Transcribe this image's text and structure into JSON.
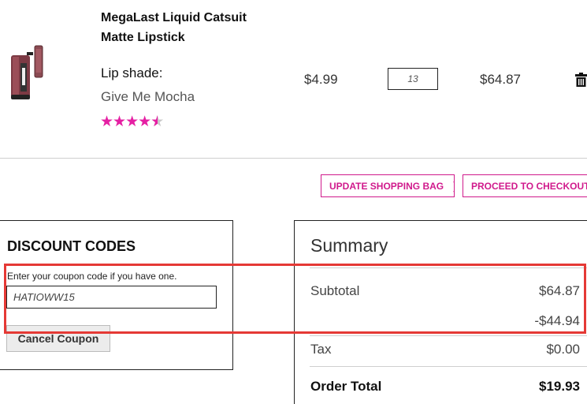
{
  "product": {
    "name_line1": "MegaLast Liquid Catsuit",
    "name_line2": "Matte Lipstick",
    "shade_label": "Lip shade:",
    "shade_value": "Give Me Mocha",
    "rating_stars": 4.5,
    "unit_price": "$4.99",
    "quantity": "13",
    "line_total": "$64.87"
  },
  "actions": {
    "update_label": "UPDATE SHOPPING BAG",
    "checkout_label": "PROCEED TO CHECKOUT"
  },
  "discount": {
    "title": "DISCOUNT CODES",
    "help": "Enter your coupon code if you have one.",
    "code": "HATIOWW15",
    "cancel_label": "Cancel Coupon"
  },
  "summary": {
    "title": "Summary",
    "subtotal_label": "Subtotal",
    "subtotal_value": "$64.87",
    "discount_value": "-$44.94",
    "tax_label": "Tax",
    "tax_value": "$0.00",
    "total_label": "Order Total",
    "total_value": "$19.93"
  },
  "colors": {
    "accent_pink": "#d01a8c",
    "highlight_red": "#e53935"
  },
  "icons": {
    "delete": "trash-icon",
    "chevron": "chevron-right-icon"
  }
}
